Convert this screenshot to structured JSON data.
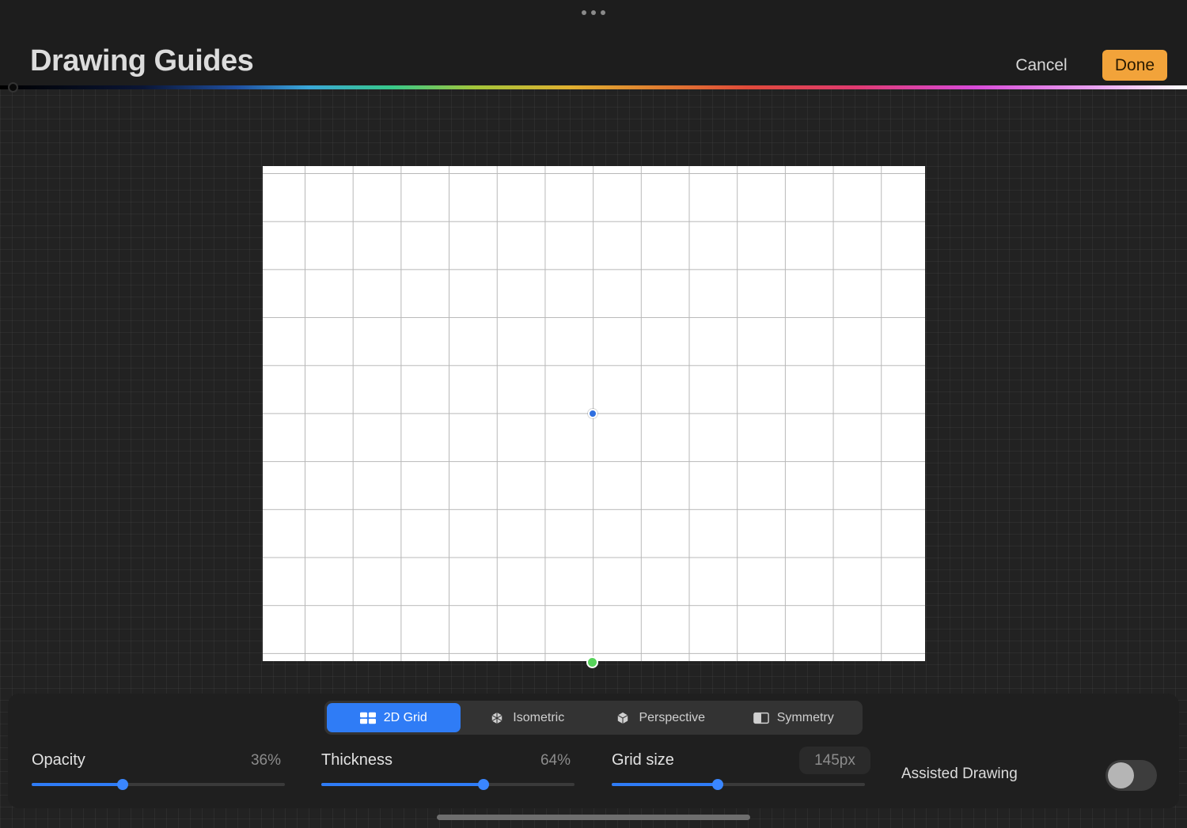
{
  "header": {
    "title": "Drawing Guides",
    "cancel_label": "Cancel",
    "done_label": "Done",
    "more_icon": "more-dots-icon",
    "accent_color": "#f2a33a"
  },
  "color_bar": {
    "handle_position": 0.01
  },
  "guide_types": [
    {
      "label": "2D Grid",
      "icon": "grid-2d-icon",
      "active": true
    },
    {
      "label": "Isometric",
      "icon": "isometric-icon",
      "active": false
    },
    {
      "label": "Perspective",
      "icon": "perspective-icon",
      "active": false
    },
    {
      "label": "Symmetry",
      "icon": "symmetry-icon",
      "active": false
    }
  ],
  "sliders": {
    "opacity": {
      "label": "Opacity",
      "value": "36%",
      "fraction": 0.36
    },
    "thickness": {
      "label": "Thickness",
      "value": "64%",
      "fraction": 0.64
    },
    "grid_size": {
      "label": "Grid size",
      "value": "145px",
      "fraction": 0.42
    }
  },
  "assisted_drawing": {
    "label": "Assisted Drawing",
    "enabled": false
  },
  "colors": {
    "active_segment": "#2f7cf6",
    "center_node": "#2f6fe0",
    "rotation_node": "#56d35a"
  }
}
